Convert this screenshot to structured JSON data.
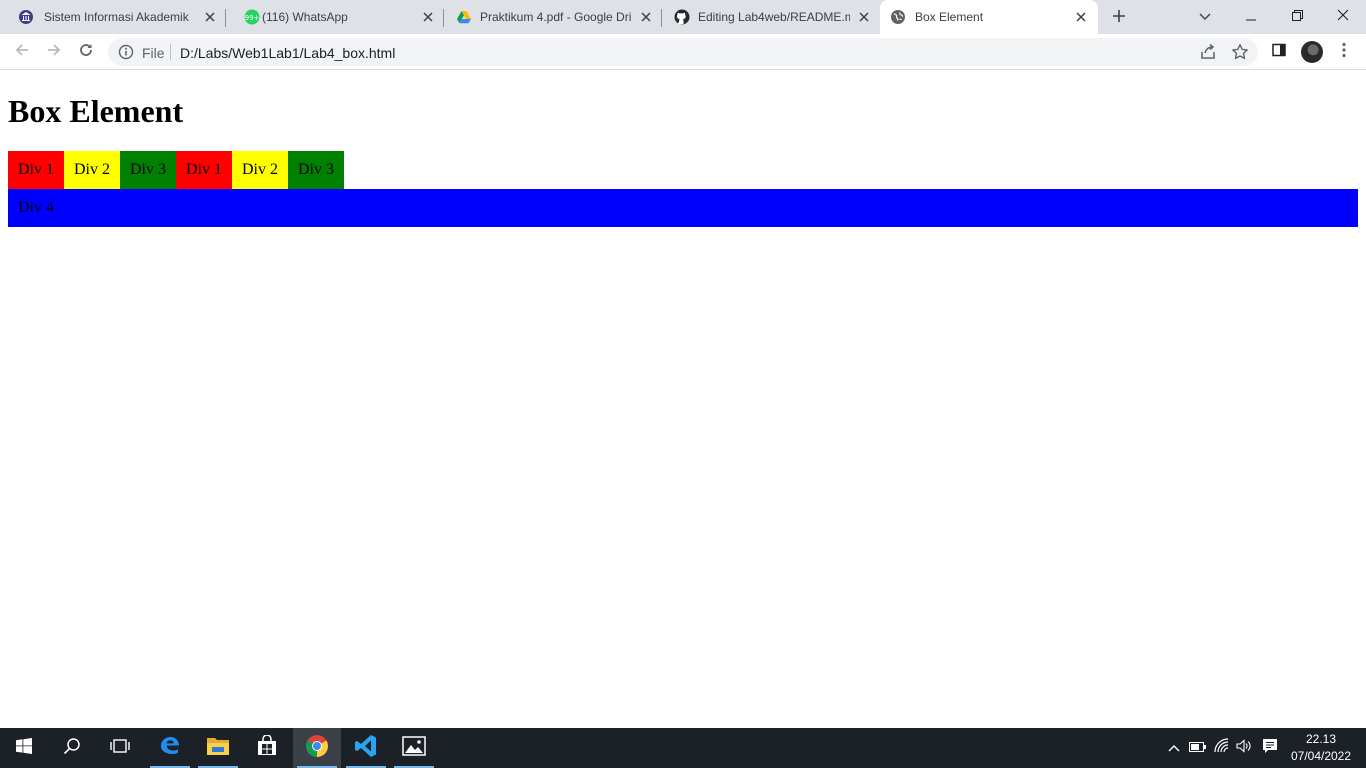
{
  "browser": {
    "tabs": [
      {
        "title": "Sistem Informasi Akademik",
        "icon": "university-icon",
        "active": false
      },
      {
        "title": "(116) WhatsApp",
        "icon": "whatsapp-icon",
        "badge": "99+",
        "active": false
      },
      {
        "title": "Praktikum 4.pdf - Google Dri",
        "icon": "google-drive-icon",
        "active": false
      },
      {
        "title": "Editing Lab4web/README.m",
        "icon": "github-icon",
        "active": false
      },
      {
        "title": "Box Element",
        "icon": "globe-icon",
        "active": true
      }
    ],
    "omnibox": {
      "scheme_label": "File",
      "url": "D:/Labs/Web1Lab1/Lab4_box.html"
    }
  },
  "page": {
    "heading": "Box Element",
    "boxes": [
      {
        "label": "Div 1",
        "color": "#ff0000"
      },
      {
        "label": "Div 2",
        "color": "#ffff00"
      },
      {
        "label": "Div 3",
        "color": "#008000"
      },
      {
        "label": "Div 1",
        "color": "#ff0000"
      },
      {
        "label": "Div 2",
        "color": "#ffff00"
      },
      {
        "label": "Div 3",
        "color": "#008000"
      }
    ],
    "full_box": {
      "label": "Div 4",
      "color": "#0000ff"
    }
  },
  "taskbar": {
    "apps": [
      "start-icon",
      "search-icon",
      "task-view-icon",
      "edge-icon",
      "file-explorer-icon",
      "store-icon",
      "chrome-icon",
      "vscode-icon",
      "photos-icon"
    ],
    "active_app": "chrome-icon",
    "clock": {
      "time": "22.13",
      "date": "07/04/2022"
    }
  },
  "colors": {
    "tabstrip": "#dee1e6",
    "taskbar": "#1c2127",
    "accent": "#1a73e8"
  }
}
